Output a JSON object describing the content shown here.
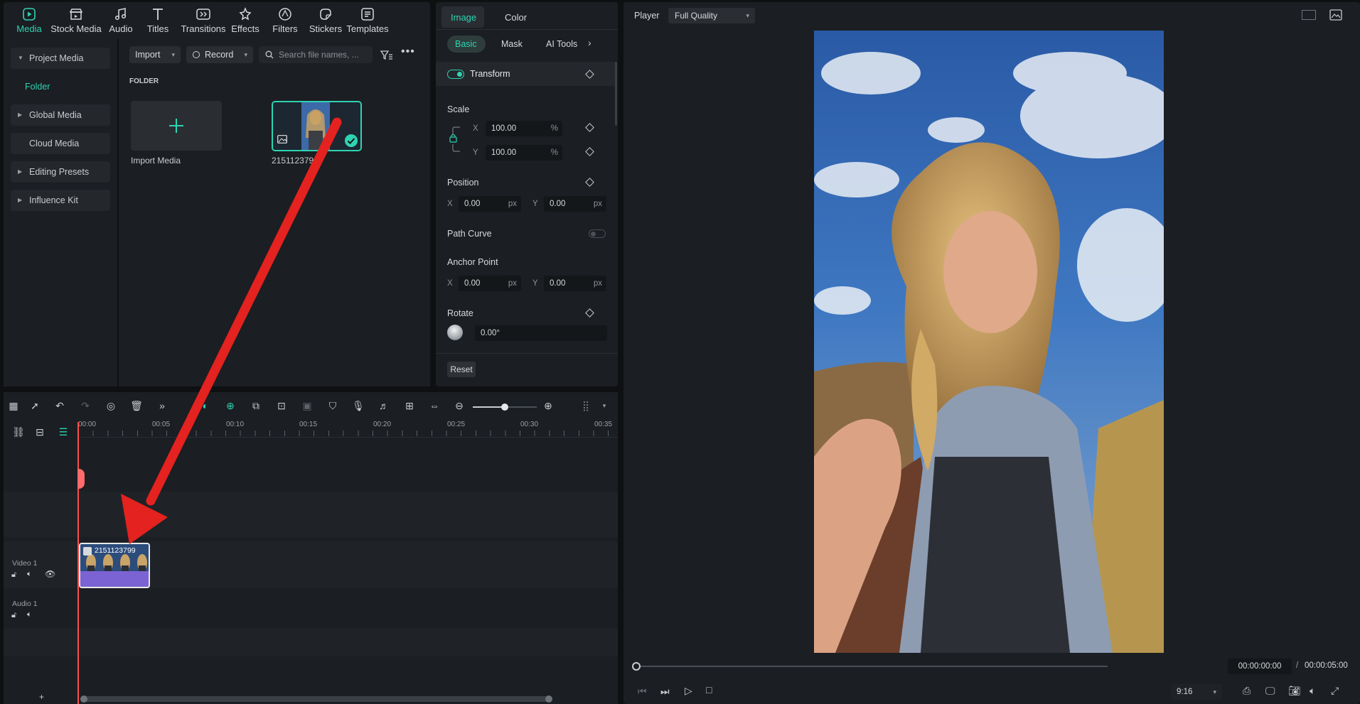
{
  "toolbar": {
    "items": [
      {
        "label": "Media",
        "icon": "media-icon"
      },
      {
        "label": "Stock Media",
        "icon": "stock-media-icon"
      },
      {
        "label": "Audio",
        "icon": "music-note-icon"
      },
      {
        "label": "Titles",
        "icon": "text-t-icon"
      },
      {
        "label": "Transitions",
        "icon": "transitions-icon"
      },
      {
        "label": "Effects",
        "icon": "effects-icon"
      },
      {
        "label": "Filters",
        "icon": "filters-icon"
      },
      {
        "label": "Stickers",
        "icon": "stickers-icon"
      },
      {
        "label": "Templates",
        "icon": "templates-icon"
      }
    ],
    "active": "Media",
    "accent": "#2dd4b3"
  },
  "sidebar": {
    "items": [
      {
        "label": "Project Media"
      },
      {
        "label": "Folder"
      },
      {
        "label": "Global Media"
      },
      {
        "label": "Cloud Media"
      },
      {
        "label": "Editing Presets"
      },
      {
        "label": "Influence Kit"
      }
    ]
  },
  "media": {
    "import_label": "Import",
    "record_label": "Record",
    "search_placeholder": "Search file names, ...",
    "folder_heading": "FOLDER",
    "import_media_label": "Import Media",
    "clip_name": "2151123799"
  },
  "props": {
    "tabs": [
      "Image",
      "Color"
    ],
    "subtabs": [
      "Basic",
      "Mask",
      "AI Tools"
    ],
    "transform_label": "Transform",
    "scale_label": "Scale",
    "scale_x": "100.00",
    "scale_y": "100.00",
    "percent": "%",
    "position_label": "Position",
    "pos_x": "0.00",
    "pos_y": "0.00",
    "px": "px",
    "path_curve_label": "Path Curve",
    "anchor_label": "Anchor Point",
    "anchor_x": "0.00",
    "anchor_y": "0.00",
    "rotate_label": "Rotate",
    "rotate_value": "0.00°",
    "reset_label": "Reset",
    "x": "X",
    "y": "Y"
  },
  "timeline": {
    "ruler": [
      "00:00",
      "00:05",
      "00:10",
      "00:15",
      "00:20",
      "00:25",
      "00:30",
      "00:35"
    ],
    "video_track": "Video 1",
    "audio_track": "Audio 1",
    "clip_label": "2151123799",
    "plus": "+"
  },
  "player": {
    "label": "Player",
    "quality": "Full Quality",
    "current_time": "00:00:00:00",
    "separator": "/",
    "total_time": "00:00:05:00",
    "ratio": "9:16"
  }
}
